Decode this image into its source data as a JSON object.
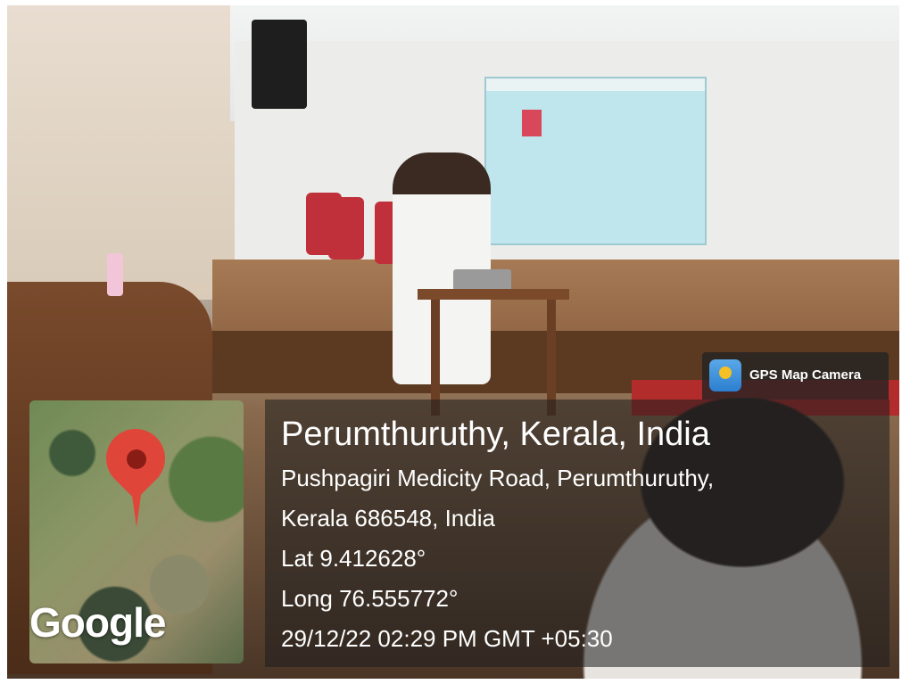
{
  "badge": {
    "label": "GPS Map Camera",
    "icon": "gps-map-camera-icon"
  },
  "location": {
    "title": "Perumthuruthy, Kerala, India",
    "address_line1": "Pushpagiri Medicity Road, Perumthuruthy,",
    "address_line2": "Kerala 686548, India",
    "lat": "Lat 9.412628°",
    "long": "Long 76.555772°",
    "datetime": "29/12/22 02:29 PM GMT +05:30"
  },
  "map": {
    "brand": "Google",
    "pin_color": "#e0453a"
  }
}
